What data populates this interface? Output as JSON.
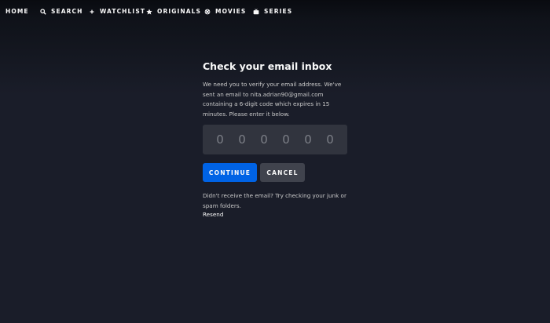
{
  "nav": {
    "items": [
      {
        "label": "HOME",
        "icon": "home-icon"
      },
      {
        "label": "SEARCH",
        "icon": "search-icon"
      },
      {
        "label": "WATCHLIST",
        "icon": "plus-icon"
      },
      {
        "label": "ORIGINALS",
        "icon": "star-icon"
      },
      {
        "label": "MOVIES",
        "icon": "film-reel-icon"
      },
      {
        "label": "SERIES",
        "icon": "tv-icon"
      }
    ]
  },
  "verify": {
    "title": "Check your email inbox",
    "description": "We need you to verify your email address. We've sent an email to nita.adrian90@gmail.com containing a 6-digit code which expires in 15 minutes. Please enter it below.",
    "code_placeholders": [
      "0",
      "0",
      "0",
      "0",
      "0",
      "0"
    ],
    "continue_label": "CONTINUE",
    "cancel_label": "CANCEL",
    "help_text": "Didn't receive the email? Try checking your junk or spam folders.",
    "resend_label": "Resend"
  },
  "colors": {
    "background": "#1a1d29",
    "primary_button": "#0063e5",
    "secondary_button": "#40434d",
    "code_box": "#31343e"
  }
}
